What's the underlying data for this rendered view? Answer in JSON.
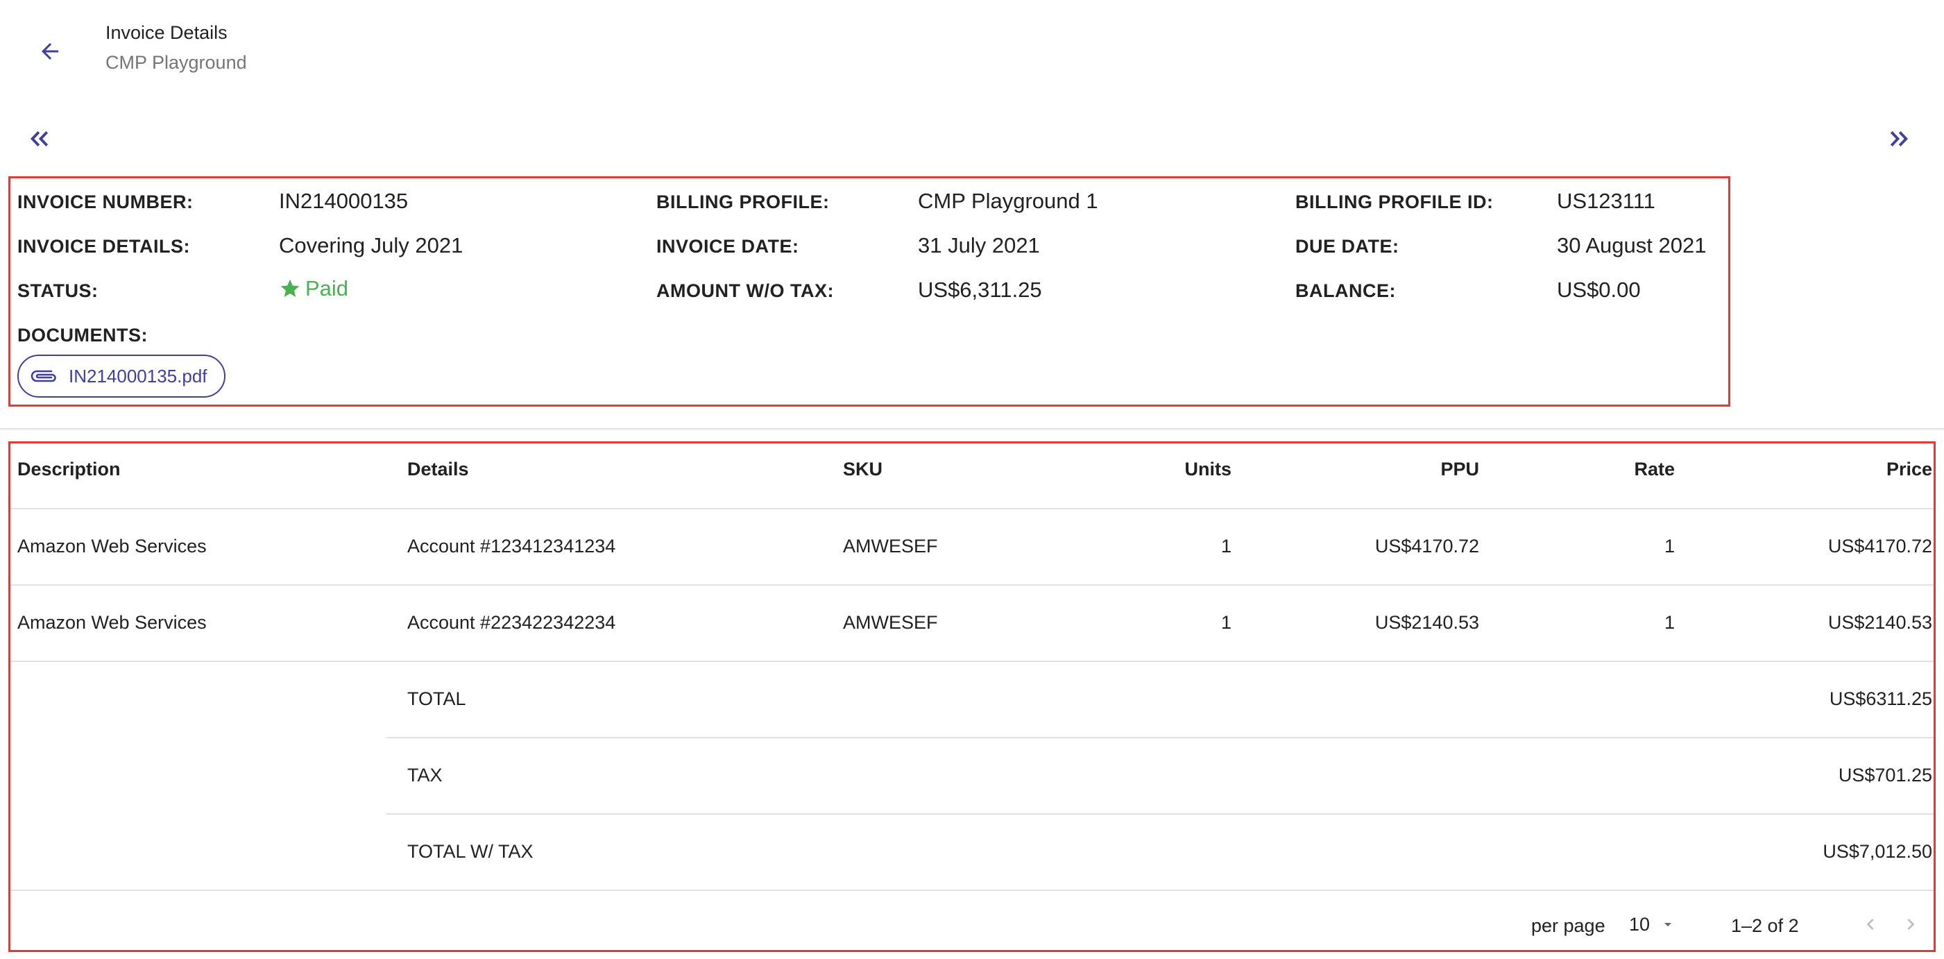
{
  "header": {
    "title": "Invoice Details",
    "subtitle": "CMP Playground"
  },
  "info": {
    "invoice_number_label": "INVOICE NUMBER:",
    "invoice_number": "IN214000135",
    "billing_profile_label": "BILLING PROFILE:",
    "billing_profile": "CMP Playground 1",
    "billing_profile_id_label": "BILLING PROFILE ID:",
    "billing_profile_id": "US123111",
    "invoice_details_label": "INVOICE DETAILS:",
    "invoice_details": "Covering July 2021",
    "invoice_date_label": "INVOICE DATE:",
    "invoice_date": "31 July 2021",
    "due_date_label": "DUE DATE:",
    "due_date": "30 August 2021",
    "status_label": "STATUS:",
    "status": "Paid",
    "amount_label": "AMOUNT W/O TAX:",
    "amount": "US$6,311.25",
    "balance_label": "BALANCE:",
    "balance": "US$0.00",
    "documents_label": "DOCUMENTS:",
    "document_file": "IN214000135.pdf"
  },
  "table": {
    "headers": {
      "description": "Description",
      "details": "Details",
      "sku": "SKU",
      "units": "Units",
      "ppu": "PPU",
      "rate": "Rate",
      "price": "Price"
    },
    "rows": [
      {
        "description": "Amazon Web Services",
        "details": "Account #123412341234",
        "sku": "AMWESEF",
        "units": "1",
        "ppu": "US$4170.72",
        "rate": "1",
        "price": "US$4170.72"
      },
      {
        "description": "Amazon Web Services",
        "details": "Account #223422342234",
        "sku": "AMWESEF",
        "units": "1",
        "ppu": "US$2140.53",
        "rate": "1",
        "price": "US$2140.53"
      }
    ],
    "totals": [
      {
        "label": "TOTAL",
        "value": "US$6311.25"
      },
      {
        "label": "TAX",
        "value": "US$701.25"
      },
      {
        "label": "TOTAL W/ TAX",
        "value": "US$7,012.50"
      }
    ]
  },
  "pagination": {
    "per_page_label": "per page",
    "per_page_value": "10",
    "range_text": "1–2 of 2"
  },
  "colors": {
    "accent": "#3f3fa0",
    "success": "#4caf50",
    "highlight_border": "#e53935"
  }
}
